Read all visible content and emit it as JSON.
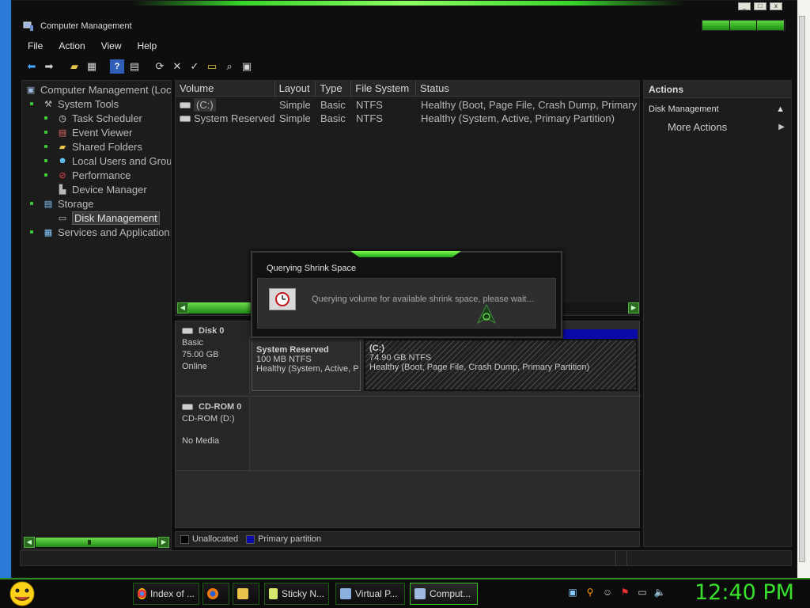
{
  "window": {
    "title": "Computer Management"
  },
  "menu": [
    "File",
    "Action",
    "View",
    "Help"
  ],
  "toolbar_icons": [
    "back-icon",
    "forward-icon",
    "up-folder-icon",
    "show-hide-tree-icon",
    "help-icon",
    "properties-icon",
    "refresh-icon",
    "delete-icon",
    "check-icon",
    "open-folder-icon",
    "search-icon",
    "export-icon"
  ],
  "tree": {
    "root": "Computer Management (Loc",
    "items": [
      {
        "label": "System Tools",
        "icon": "tools-icon"
      },
      {
        "label": "Task Scheduler",
        "icon": "clock-icon"
      },
      {
        "label": "Event Viewer",
        "icon": "event-viewer-icon"
      },
      {
        "label": "Shared Folders",
        "icon": "shared-folder-icon"
      },
      {
        "label": "Local Users and Grou",
        "icon": "users-icon"
      },
      {
        "label": "Performance",
        "icon": "performance-icon"
      },
      {
        "label": "Device Manager",
        "icon": "device-manager-icon"
      },
      {
        "label": "Storage",
        "icon": "storage-icon"
      },
      {
        "label": "Disk Management",
        "icon": "disk-icon"
      },
      {
        "label": "Services and Application",
        "icon": "services-icon"
      }
    ]
  },
  "volumes": {
    "headers": [
      "Volume",
      "Layout",
      "Type",
      "File System",
      "Status"
    ],
    "rows": [
      {
        "volume": "(C:)",
        "layout": "Simple",
        "type": "Basic",
        "fs": "NTFS",
        "status": "Healthy (Boot, Page File, Crash Dump, Primary"
      },
      {
        "volume": "System Reserved",
        "layout": "Simple",
        "type": "Basic",
        "fs": "NTFS",
        "status": "Healthy (System, Active, Primary Partition)"
      }
    ]
  },
  "disks": {
    "disk0": {
      "name": "Disk 0",
      "type": "Basic",
      "size": "75.00 GB",
      "state": "Online"
    },
    "cdrom0": {
      "name": "CD-ROM 0",
      "drive": "CD-ROM (D:)",
      "state": "No Media"
    },
    "partitions": [
      {
        "name": "System Reserved",
        "size": "100 MB NTFS",
        "status": "Healthy (System, Active, P"
      },
      {
        "name": "(C:)",
        "size": "74.90 GB NTFS",
        "status": "Healthy (Boot, Page File, Crash Dump, Primary Partition)"
      }
    ]
  },
  "legend": {
    "unallocated": "Unallocated",
    "primary": "Primary partition",
    "unallocated_color": "#000000",
    "primary_color": "#0a0aa8"
  },
  "actions": {
    "header": "Actions",
    "section": "Disk Management",
    "more": "More Actions"
  },
  "dialog": {
    "title": "Querying Shrink Space",
    "message": "Querying volume for available shrink space, please wait..."
  },
  "taskbar": {
    "items": [
      {
        "label": "Index of ...",
        "icon": "chrome-icon"
      },
      {
        "label": "",
        "icon": "firefox-icon"
      },
      {
        "label": "",
        "icon": "folder-icon"
      },
      {
        "label": "Sticky N...",
        "icon": "sticky-notes-icon"
      },
      {
        "label": "Virtual P...",
        "icon": "virtual-pc-icon"
      },
      {
        "label": "Comput...",
        "icon": "computer-management-icon"
      }
    ],
    "tray_icons": [
      "network-icon",
      "search-icon",
      "messenger-icon",
      "flag-icon",
      "display-icon",
      "volume-icon"
    ],
    "clock": "12:40 PM"
  },
  "colors": {
    "accent_green": "#37e02a",
    "window_bg": "#0e0e0e"
  }
}
